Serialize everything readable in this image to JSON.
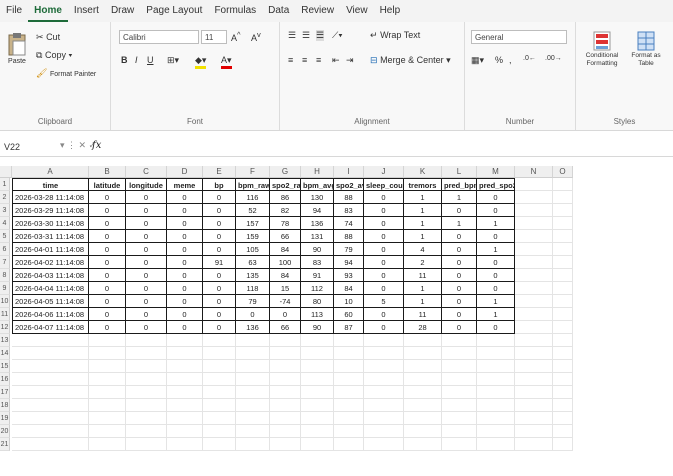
{
  "menu": [
    "File",
    "Home",
    "Insert",
    "Draw",
    "Page Layout",
    "Formulas",
    "Data",
    "Review",
    "View",
    "Help"
  ],
  "ribbon": {
    "clipboard": {
      "paste": "Paste",
      "cut": "Cut",
      "copy": "Copy",
      "format_painter": "Format Painter",
      "label": "Clipboard"
    },
    "font": {
      "name": "Calibri",
      "size": "11",
      "label": "Font"
    },
    "alignment": {
      "wrap": "Wrap Text",
      "merge": "Merge & Center",
      "label": "Alignment"
    },
    "number": {
      "format": "General",
      "label": "Number"
    },
    "styles": {
      "conditional": "Conditional Formatting",
      "table": "Format as Table",
      "label": "Styles"
    }
  },
  "formula_bar": {
    "name_box": "V22",
    "fx": "fx",
    "value": ""
  },
  "columns": [
    "A",
    "B",
    "C",
    "D",
    "E",
    "F",
    "G",
    "H",
    "I",
    "J",
    "K",
    "L",
    "M",
    "N",
    "O"
  ],
  "row_numbers": [
    "1",
    "2",
    "3",
    "4",
    "5",
    "6",
    "7",
    "8",
    "9",
    "10",
    "11",
    "12",
    "13",
    "14",
    "15",
    "16",
    "17",
    "18",
    "19",
    "20",
    "21"
  ],
  "table": {
    "headers": [
      "time",
      "latitude",
      "longitude",
      "meme",
      "bp",
      "bpm_raw",
      "spo2_raw",
      "bpm_avg",
      "spo2_avg",
      "sleep_count",
      "tremors",
      "pred_bpm",
      "pred_spo2"
    ],
    "rows": [
      [
        "2026-03-28 11:14:08",
        "0",
        "0",
        "0",
        "0",
        "116",
        "86",
        "130",
        "88",
        "0",
        "1",
        "1",
        "0"
      ],
      [
        "2026-03-29 11:14:08",
        "0",
        "0",
        "0",
        "0",
        "52",
        "82",
        "94",
        "83",
        "0",
        "1",
        "0",
        "0"
      ],
      [
        "2026-03-30 11:14:08",
        "0",
        "0",
        "0",
        "0",
        "157",
        "78",
        "136",
        "74",
        "0",
        "1",
        "1",
        "1"
      ],
      [
        "2026-03-31 11:14:08",
        "0",
        "0",
        "0",
        "0",
        "159",
        "66",
        "131",
        "88",
        "0",
        "1",
        "0",
        "0"
      ],
      [
        "2026-04-01 11:14:08",
        "0",
        "0",
        "0",
        "0",
        "105",
        "84",
        "90",
        "79",
        "0",
        "4",
        "0",
        "1"
      ],
      [
        "2026-04-02 11:14:08",
        "0",
        "0",
        "0",
        "91",
        "63",
        "100",
        "83",
        "94",
        "0",
        "2",
        "0",
        "0"
      ],
      [
        "2026-04-03 11:14:08",
        "0",
        "0",
        "0",
        "0",
        "135",
        "84",
        "91",
        "93",
        "0",
        "11",
        "0",
        "0"
      ],
      [
        "2026-04-04 11:14:08",
        "0",
        "0",
        "0",
        "0",
        "118",
        "15",
        "112",
        "84",
        "0",
        "1",
        "0",
        "0"
      ],
      [
        "2026-04-05 11:14:08",
        "0",
        "0",
        "0",
        "0",
        "79",
        "-74",
        "80",
        "10",
        "5",
        "1",
        "0",
        "1"
      ],
      [
        "2026-04-06 11:14:08",
        "0",
        "0",
        "0",
        "0",
        "0",
        "0",
        "113",
        "60",
        "0",
        "11",
        "0",
        "1"
      ],
      [
        "2026-04-07 11:14:08",
        "0",
        "0",
        "0",
        "0",
        "136",
        "66",
        "90",
        "87",
        "0",
        "28",
        "0",
        "0"
      ]
    ]
  }
}
